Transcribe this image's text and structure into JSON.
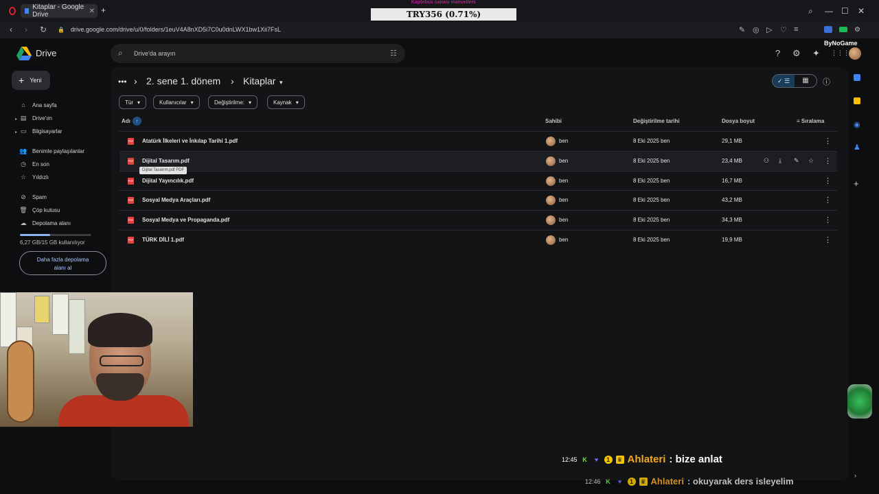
{
  "browser": {
    "tab_title": "Kitaplar - Google Drive",
    "new_tab": "+",
    "tab_close": "✕",
    "url": "drive.google.com/drive/u/0/folders/1euV4A8nXD5i7C0u0dnLWX1bw1Xii7FsL",
    "back": "‹",
    "forward": "›",
    "reload": "↻",
    "lock": "🔒",
    "window_controls": {
      "search": "⌕",
      "minimize": "—",
      "maximize": "☐",
      "close": "✕"
    },
    "addr_icons": [
      "✎",
      "◎",
      "▷",
      "♡",
      "≡"
    ]
  },
  "ticker": {
    "label": "TRY356 (0.71%)",
    "top_label": "Kaptebus canası manvellers"
  },
  "drive": {
    "app_name": "Drive",
    "search_placeholder": "Drive'da arayın",
    "new_button": "Yeni",
    "new_plus": "+",
    "top_icons": {
      "help": "?",
      "settings": "⚙",
      "gemini": "✦",
      "apps": "⋮⋮"
    },
    "sidebar": [
      {
        "label": "Ana sayfa",
        "icon": "⌂"
      },
      {
        "label": "Drive'ım",
        "icon": "▤"
      },
      {
        "label": "Bilgisayarlar",
        "icon": "▭"
      },
      {
        "label": "Benimle paylaşılanlar",
        "icon": "👥"
      },
      {
        "label": "En son",
        "icon": "◷"
      },
      {
        "label": "Yıldızlı",
        "icon": "☆"
      },
      {
        "label": "Spam",
        "icon": "⊘"
      },
      {
        "label": "Çöp kutusu",
        "icon": "🗑"
      },
      {
        "label": "Depolama alanı",
        "icon": "☁"
      }
    ],
    "storage": {
      "text": "6,27 GB/15 GB kullanılıyor",
      "fraction": 0.42,
      "button_line1": "Daha fazla depolama",
      "button_line2": "alanı al"
    },
    "breadcrumb": {
      "more": "•••",
      "sep": "›",
      "parent": "2. sene 1. dönem",
      "current": "Kitaplar",
      "current_caret": "▾"
    },
    "filters": [
      {
        "label": "Tür"
      },
      {
        "label": "Kullanıcılar"
      },
      {
        "label": "Değiştirilme:"
      },
      {
        "label": "Kaynak"
      }
    ],
    "filter_caret": "▾",
    "view": {
      "list": "✓ ☰",
      "grid": "▦",
      "info": "ⓘ"
    },
    "columns": {
      "name": "Adı",
      "owner": "Sahibi",
      "modified": "Değiştirilme tarihi",
      "size": "Dosya boyut",
      "sort": "Sıralama",
      "sort_arrow": "↑",
      "sort_icon": "≡"
    },
    "files": [
      {
        "name": "Atatürk İlkeleri ve İnkılap Tarihi 1.pdf",
        "owner": "ben",
        "modified": "8 Eki 2025 ben",
        "size": "29,1 MB"
      },
      {
        "name": "Dijital Tasarım.pdf",
        "owner": "ben",
        "modified": "8 Eki 2025 ben",
        "size": "23,4 MB"
      },
      {
        "name": "Dijital Yayıncılık.pdf",
        "owner": "ben",
        "modified": "8 Eki 2025 ben",
        "size": "16,7 MB"
      },
      {
        "name": "Sosyal Medya Araçları.pdf",
        "owner": "ben",
        "modified": "8 Eki 2025 ben",
        "size": "43,2 MB"
      },
      {
        "name": "Sosyal Medya ve Propaganda.pdf",
        "owner": "ben",
        "modified": "8 Eki 2025 ben",
        "size": "34,3 MB"
      },
      {
        "name": "TÜRK DİLİ 1.pdf",
        "owner": "ben",
        "modified": "8 Eki 2025 ben",
        "size": "19,9 MB"
      }
    ],
    "pdf_label": "PDF",
    "row_more": "⋮",
    "row_actions": {
      "share": "⚇",
      "download": "⤓",
      "rename": "✎",
      "star": "☆"
    },
    "tooltip": "Dijital Tasarım.pdf PDF"
  },
  "overlay": {
    "brand": "ByNoGame",
    "chat": [
      {
        "time": "12:45",
        "user": "Ahlateri",
        "message": ": bize anlat"
      },
      {
        "time": "12:46",
        "user": "Ahlateri",
        "message": ": okuyarak ders isleyelim"
      }
    ],
    "badge_k": "K",
    "badge_1": "1",
    "badge_heart": "♥",
    "badge_crown": "♛"
  },
  "colors": {
    "accent": "#8ab4f8",
    "pdf": "#e0443e",
    "chat_user": "#f5a623"
  }
}
